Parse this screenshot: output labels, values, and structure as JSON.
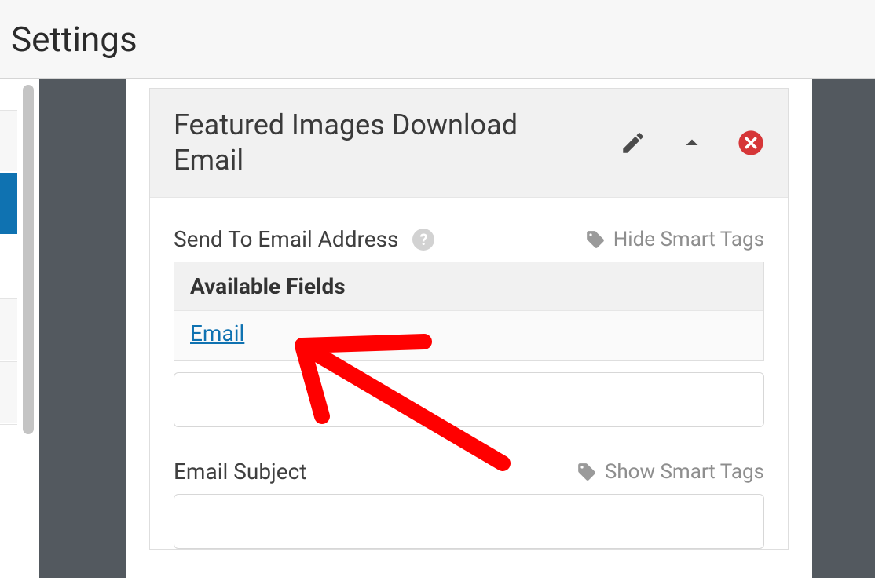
{
  "header": {
    "title": "Settings"
  },
  "panel": {
    "title": "Featured Images Download Email",
    "sendTo": {
      "label": "Send To Email Address",
      "smartTagsToggle": "Hide Smart Tags",
      "availableFieldsHeading": "Available Fields",
      "fields": [
        "Email"
      ],
      "value": ""
    },
    "subject": {
      "label": "Email Subject",
      "smartTagsToggle": "Show Smart Tags",
      "value": ""
    }
  }
}
